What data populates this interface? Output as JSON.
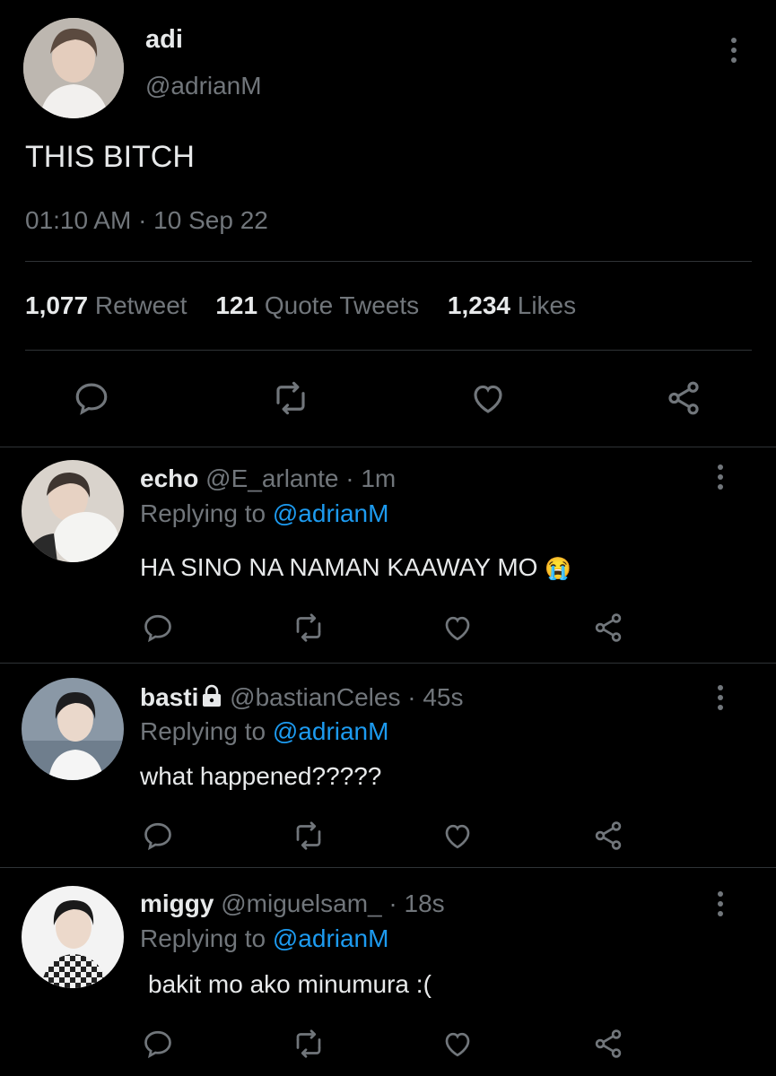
{
  "main_tweet": {
    "display_name": "adi",
    "handle": "@adrianM",
    "text": "THIS BITCH",
    "timestamp": "01:10 AM · 10 Sep 22",
    "stats": {
      "retweets_count": "1,077",
      "retweets_label": "Retweet",
      "quotes_count": "121",
      "quotes_label": "Quote Tweets",
      "likes_count": "1,234",
      "likes_label": "Likes"
    }
  },
  "replies": [
    {
      "display_name": "echo",
      "handle": "@E_arlante",
      "separator": "·",
      "time": "1m",
      "replying_prefix": "Replying to",
      "replying_handle": "@adrianM",
      "text": "HA SINO NA NAMAN KAAWAY MO",
      "emoji": "😭"
    },
    {
      "display_name": "basti",
      "handle": "@bastianCeles",
      "separator": "·",
      "time": "45s",
      "replying_prefix": "Replying to",
      "replying_handle": "@adrianM",
      "text": "what happened?????",
      "locked": true
    },
    {
      "display_name": "miggy",
      "handle": "@miguelsam_",
      "separator": "·",
      "time": "18s",
      "replying_prefix": "Replying to",
      "replying_handle": "@adrianM",
      "text": "bakit mo ako minumura :("
    }
  ],
  "icons": {
    "reply": "reply-icon",
    "retweet": "retweet-icon",
    "like": "heart-icon",
    "share": "share-icon",
    "more": "more-vertical-icon",
    "lock": "lock-icon"
  },
  "colors": {
    "background": "#000000",
    "text": "#e7e9ea",
    "muted": "#71767b",
    "link": "#1d9bf0",
    "divider": "#2f3336"
  }
}
